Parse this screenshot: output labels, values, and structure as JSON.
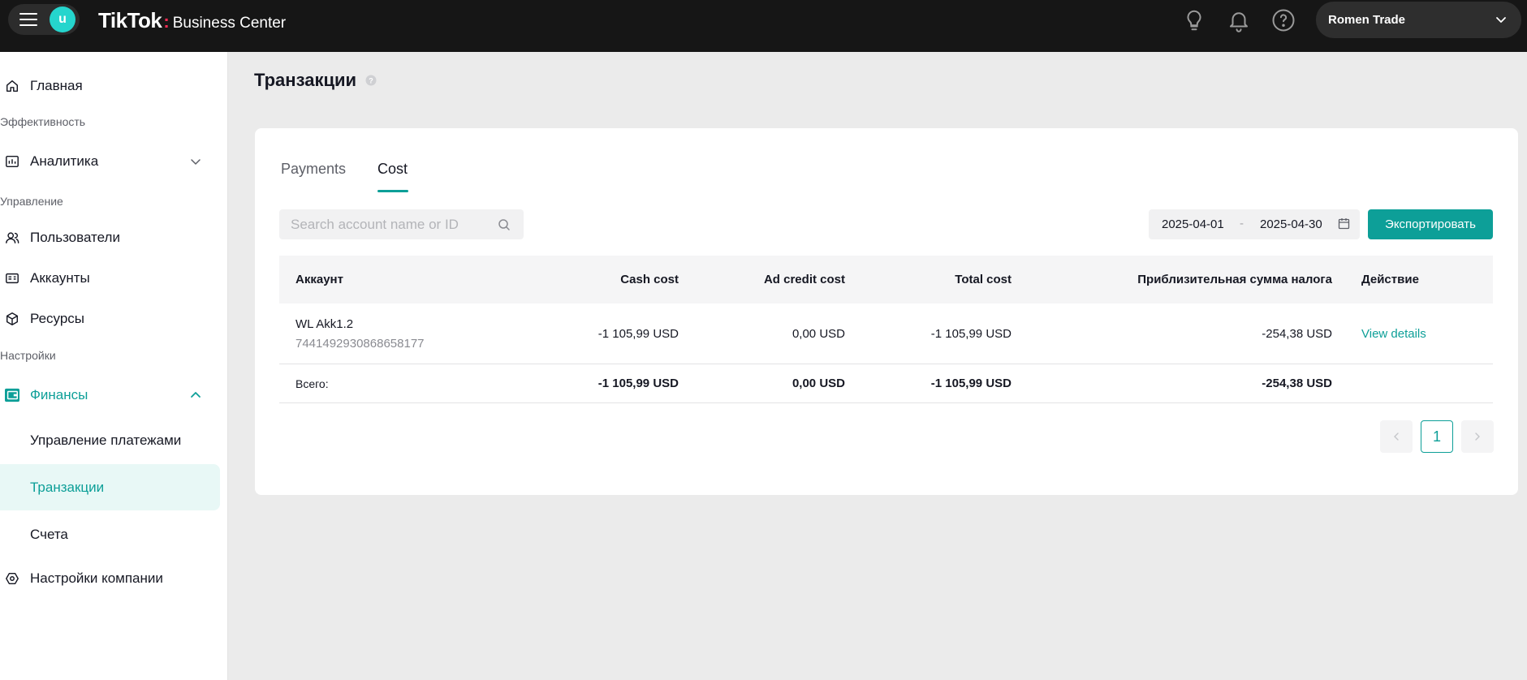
{
  "topbar": {
    "avatar_letter": "u",
    "brand_tiktok": "TikTok",
    "brand_dot": ":",
    "brand_bc": "Business Center",
    "company": "Romen Trade",
    "icons": [
      "lightbulb-icon",
      "bell-icon",
      "help-circle-icon",
      "chevron-down-icon"
    ]
  },
  "sidebar": {
    "home": "Главная",
    "section_efficiency": "Эффективность",
    "analytics": "Аналитика",
    "section_management": "Управление",
    "users": "Пользователи",
    "accounts": "Аккаунты",
    "resources": "Ресурсы",
    "section_settings": "Настройки",
    "finance": "Финансы",
    "payment_management": "Управление платежами",
    "transactions": "Транзакции",
    "invoices": "Счета",
    "company_settings": "Настройки компании"
  },
  "page": {
    "title": "Транзакции"
  },
  "tabs": {
    "payments": "Payments",
    "cost": "Cost",
    "active": "Cost"
  },
  "filters": {
    "search_placeholder": "Search account name or ID",
    "date_from": "2025-04-01",
    "date_sep": "-",
    "date_to": "2025-04-30",
    "export_label": "Экспортировать"
  },
  "table": {
    "headers": {
      "account": "Аккаунт",
      "cash_cost": "Cash cost",
      "ad_credit_cost": "Ad credit cost",
      "total_cost": "Total cost",
      "tax": "Приблизительная сумма налога",
      "action": "Действие"
    },
    "rows": [
      {
        "account_name": "WL Akk1.2",
        "account_id": "7441492930868658177",
        "cash_cost": "-1 105,99 USD",
        "ad_credit_cost": "0,00 USD",
        "total_cost": "-1 105,99 USD",
        "tax": "-254,38 USD",
        "action": "View details"
      }
    ],
    "totals": {
      "label": "Всего:",
      "cash_cost": "-1 105,99 USD",
      "ad_credit_cost": "0,00 USD",
      "total_cost": "-1 105,99 USD",
      "tax": "-254,38 USD"
    }
  },
  "pagination": {
    "current_page": "1"
  },
  "colors": {
    "accent": "#0d9f98",
    "topbar": "#161616",
    "active_bg": "#e8f8f6"
  }
}
